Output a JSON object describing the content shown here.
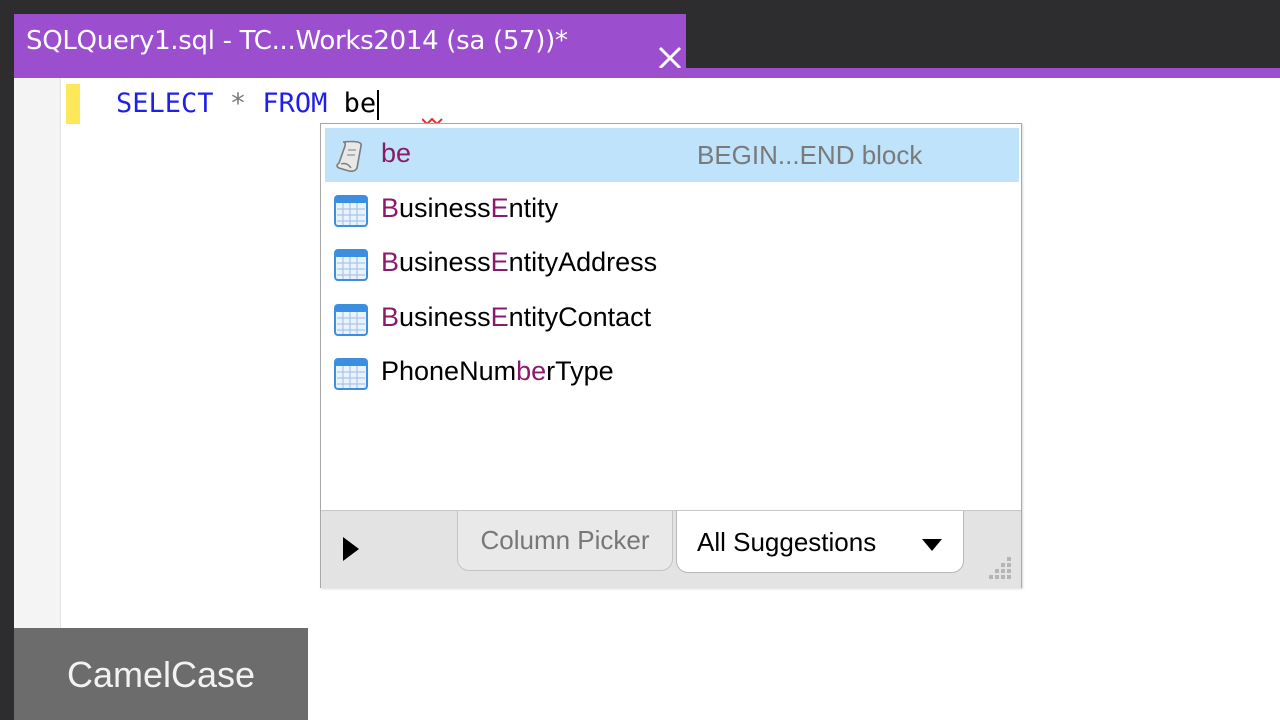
{
  "tab": {
    "title": "SQLQuery1.sql - TC...Works2014 (sa (57))*",
    "close_icon": "close-icon",
    "accent_color": "#9b4fcf"
  },
  "editor": {
    "code": {
      "keyword1": "SELECT",
      "star": "*",
      "keyword2": "FROM",
      "typed": "be"
    },
    "keyword_color": "#1f1fe8"
  },
  "completion": {
    "items": [
      {
        "icon": "snippet-icon",
        "parts": [
          {
            "t": "be",
            "h": true
          }
        ],
        "description": "BEGIN...END block",
        "selected": true
      },
      {
        "icon": "table-icon",
        "parts": [
          {
            "t": "B",
            "h": true
          },
          {
            "t": "usiness",
            "h": false
          },
          {
            "t": "E",
            "h": true
          },
          {
            "t": "ntity",
            "h": false
          }
        ],
        "description": "",
        "selected": false
      },
      {
        "icon": "table-icon",
        "parts": [
          {
            "t": "B",
            "h": true
          },
          {
            "t": "usiness",
            "h": false
          },
          {
            "t": "E",
            "h": true
          },
          {
            "t": "ntityAddress",
            "h": false
          }
        ],
        "description": "",
        "selected": false
      },
      {
        "icon": "table-icon",
        "parts": [
          {
            "t": "B",
            "h": true
          },
          {
            "t": "usiness",
            "h": false
          },
          {
            "t": "E",
            "h": true
          },
          {
            "t": "ntityContact",
            "h": false
          }
        ],
        "description": "",
        "selected": false
      },
      {
        "icon": "table-icon",
        "parts": [
          {
            "t": "PhoneNum",
            "h": false
          },
          {
            "t": "be",
            "h": true
          },
          {
            "t": "rType",
            "h": false
          }
        ],
        "description": "",
        "selected": false
      }
    ],
    "match_color": "#8b1a6b",
    "selected_bg": "#bfe3fb",
    "toolbar": {
      "column_picker_label": "Column Picker",
      "all_suggestions_label": "All Suggestions"
    }
  },
  "caption": "CamelCase"
}
